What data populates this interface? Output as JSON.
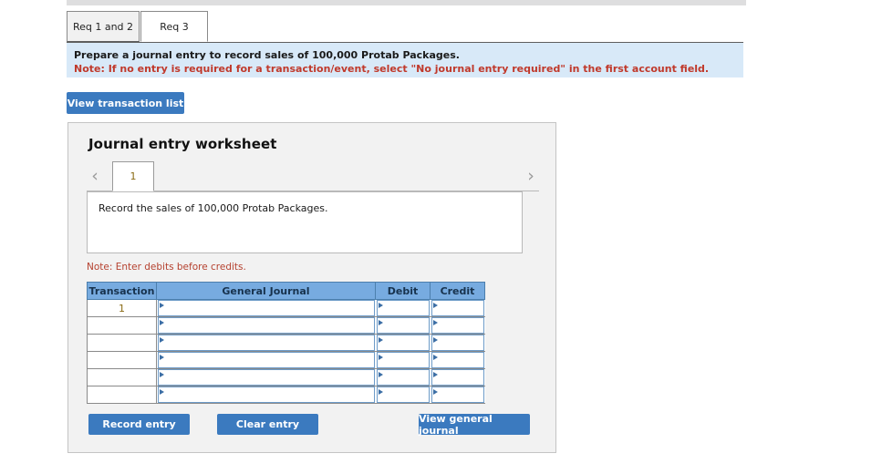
{
  "tabs": [
    {
      "label": "Req 1 and 2",
      "active": false
    },
    {
      "label": "Req 3",
      "active": true
    }
  ],
  "banner": {
    "line1": "Prepare a journal entry to record sales of 100,000 Protab Packages.",
    "line2": "Note: If no entry is required for a transaction/event, select \"No journal entry required\" in the first account field."
  },
  "toolbar": {
    "view_transaction_list_label": "View transaction list"
  },
  "worksheet": {
    "title": "Journal entry worksheet",
    "pager": {
      "prev_icon": "chevron-left-icon",
      "next_icon": "chevron-right-icon",
      "prev_glyph": "‹",
      "next_glyph": "›",
      "pages": [
        "1"
      ],
      "active_page": "1"
    },
    "description": "Record the sales of 100,000 Protab Packages.",
    "note": "Note: Enter debits before credits.",
    "table": {
      "headers": [
        "Transaction",
        "General Journal",
        "Debit",
        "Credit"
      ],
      "rows": [
        {
          "transaction": "1",
          "general_journal": "",
          "debit": "",
          "credit": ""
        },
        {
          "transaction": "",
          "general_journal": "",
          "debit": "",
          "credit": ""
        },
        {
          "transaction": "",
          "general_journal": "",
          "debit": "",
          "credit": ""
        },
        {
          "transaction": "",
          "general_journal": "",
          "debit": "",
          "credit": ""
        },
        {
          "transaction": "",
          "general_journal": "",
          "debit": "",
          "credit": ""
        },
        {
          "transaction": "",
          "general_journal": "",
          "debit": "",
          "credit": ""
        }
      ]
    },
    "actions": {
      "record_entry_label": "Record entry",
      "clear_entry_label": "Clear entry",
      "view_general_journal_label": "View general journal"
    }
  },
  "colors": {
    "button_blue": "#3b7abf",
    "table_header_blue": "#77abe0",
    "banner_blue": "#d8e9f8",
    "panel_gray": "#f2f2f2",
    "note_red": "#b5412f",
    "banner_note_red": "#c0392b",
    "page_number_gold": "#8a6a14"
  }
}
